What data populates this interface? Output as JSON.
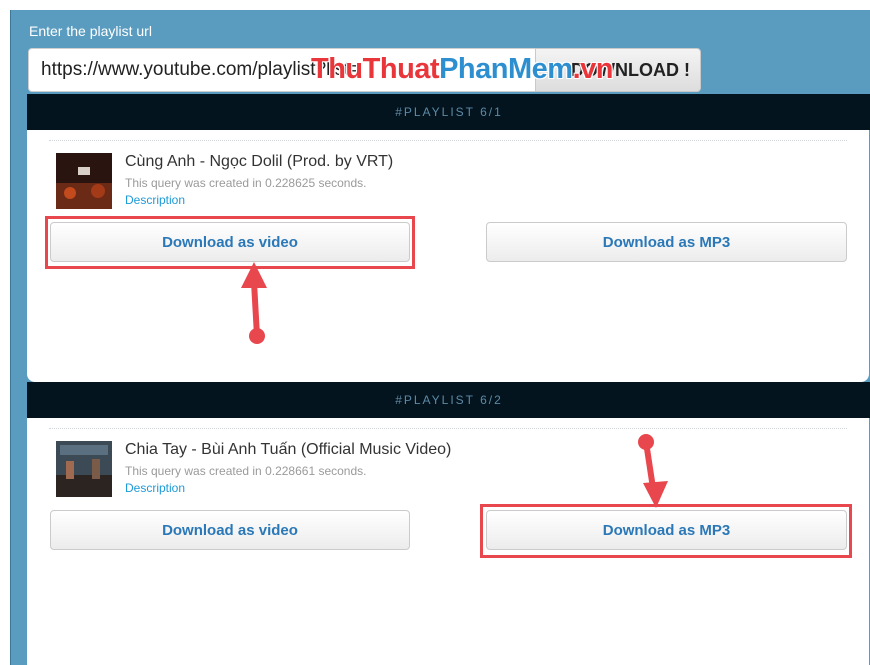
{
  "url_section": {
    "label": "Enter the playlist url",
    "url_value": "https://www.youtube.com/playlist?list=",
    "download_button": "DOWNLOAD !"
  },
  "watermark": {
    "part1": "ThuThuat",
    "part2": "PhanMem",
    "part3": ".vn"
  },
  "items": [
    {
      "header": "#PLAYLIST 6/1",
      "title": "Cùng Anh - Ngọc Dolil (Prod. by VRT)",
      "query": "This query was created in 0.228625 seconds.",
      "description": "Description",
      "video_button": "Download as video",
      "mp3_button": "Download as MP3",
      "highlighted": "video"
    },
    {
      "header": "#PLAYLIST 6/2",
      "title": "Chia Tay - Bùi Anh Tuấn (Official Music Video)",
      "query": "This query was created in 0.228661 seconds.",
      "description": "Description",
      "video_button": "Download as video",
      "mp3_button": "Download as MP3",
      "highlighted": "mp3"
    }
  ],
  "colors": {
    "frame": "#5a9cbf",
    "header_bar": "#03141e",
    "header_text": "#5d8aa6",
    "button_text": "#2a78b7",
    "highlight": "#e8474d",
    "link": "#1e9ad6"
  }
}
